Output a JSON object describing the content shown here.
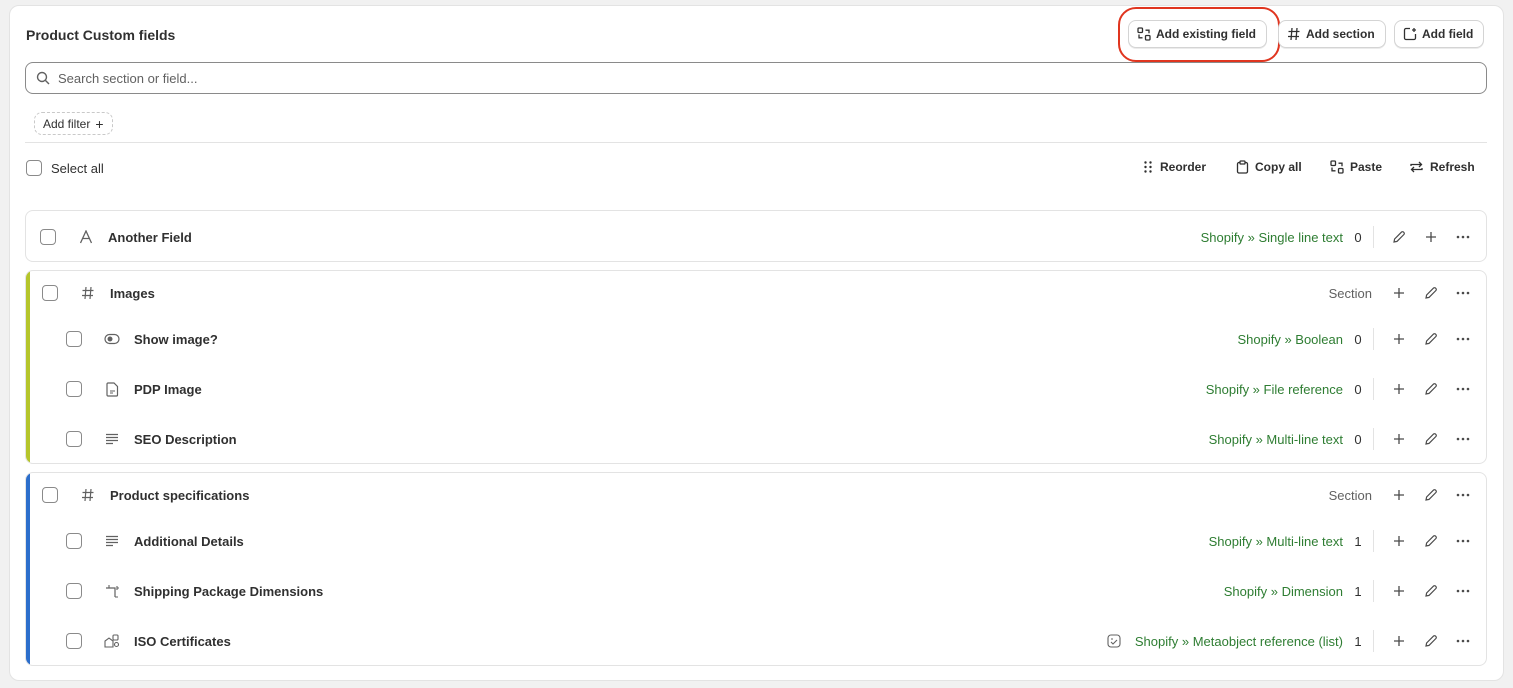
{
  "header": {
    "title": "Product Custom fields",
    "add_existing_label": "Add existing field",
    "add_section_label": "Add section",
    "add_field_label": "Add field"
  },
  "search": {
    "placeholder": "Search section or field..."
  },
  "filter": {
    "label": "Add filter",
    "plus": "+"
  },
  "toolbar": {
    "select_all": "Select all",
    "reorder": "Reorder",
    "copy_all": "Copy all",
    "paste": "Paste",
    "refresh": "Refresh"
  },
  "colors": {
    "type_green": "#2e7d32",
    "images_bar": "#b5c52b",
    "specs_bar": "#2c6ecb",
    "highlight": "#e0351f"
  },
  "fields": [
    {
      "label": "Another Field",
      "icon": "text-a-icon",
      "type": "Shopify » Single line text",
      "count": "0"
    }
  ],
  "sections": [
    {
      "label": "Images",
      "icon": "hash-icon",
      "type": "Section",
      "fields": [
        {
          "label": "Show image?",
          "icon": "toggle-icon",
          "type": "Shopify » Boolean",
          "count": "0"
        },
        {
          "label": "PDP Image",
          "icon": "file-icon",
          "type": "Shopify » File reference",
          "count": "0"
        },
        {
          "label": "SEO Description",
          "icon": "multiline-text-icon",
          "type": "Shopify » Multi-line text",
          "count": "0"
        }
      ]
    },
    {
      "label": "Product specifications",
      "icon": "hash-icon",
      "type": "Section",
      "fields": [
        {
          "label": "Additional Details",
          "icon": "multiline-text-icon",
          "type": "Shopify » Multi-line text",
          "count": "1"
        },
        {
          "label": "Shipping Package Dimensions",
          "icon": "dimension-icon",
          "type": "Shopify » Dimension",
          "count": "1"
        },
        {
          "label": "ISO Certificates",
          "icon": "metaobject-icon",
          "type": "Shopify » Metaobject reference (list)",
          "count": "1"
        }
      ]
    }
  ]
}
